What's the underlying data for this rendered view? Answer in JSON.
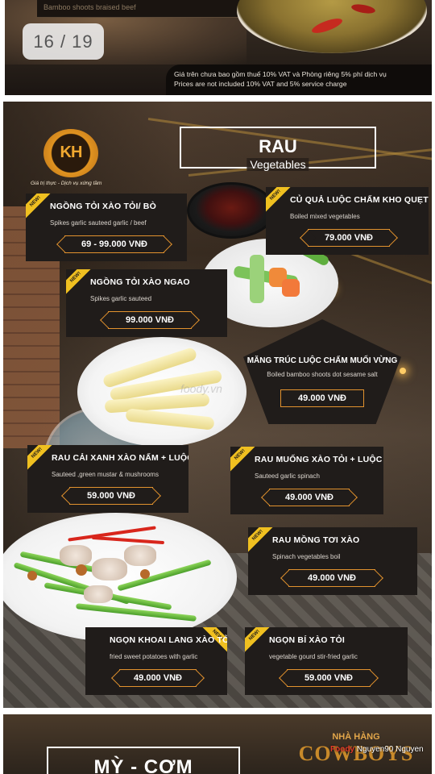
{
  "pager": {
    "label": "16 / 19"
  },
  "prev_page": {
    "band_text": "Bamboo shoots braised beef",
    "footer_vi": "Giá trên chưa bao gồm thuế 10% VAT và Phòng riêng 5% phí dịch vụ",
    "footer_en": "Prices are not included 10% VAT and 5% service charge"
  },
  "header": {
    "logo_mark": "KH",
    "tagline": "Giá trị thực - Dịch vụ xứng tầm",
    "title_vi": "RAU",
    "title_en": "Vegetables"
  },
  "badge_text": "NEW!",
  "menu_items": [
    {
      "name": "NGỒNG TỎI XÀO TỎI/ BÒ",
      "desc": "Spikes garlic sauteed garlic / beef",
      "price": "69 - 99.000 VNĐ"
    },
    {
      "name": "CỦ QUẢ LUỘC CHẤM KHO QUẸT",
      "desc": "Boiled mixed vegetables",
      "price": "79.000 VNĐ"
    },
    {
      "name": "NGỒNG TỎI XÀO NGAO",
      "desc": "Spikes garlic sauteed",
      "price": "99.000 VNĐ"
    },
    {
      "name": "MĂNG TRÚC LUỘC CHẤM MUỐI VỪNG",
      "desc": "Boiled bamboo shoots dot sesame salt",
      "price": "49.000 VNĐ"
    },
    {
      "name": "RAU CẢI XANH XÀO NẤM + LUỘC",
      "desc": "Sauteed ,green mustar & mushrooms",
      "price": "59.000 VNĐ"
    },
    {
      "name": "RAU MUỐNG XÀO TỎI + LUỘC",
      "desc": "Sauteed garlic spinach",
      "price": "49.000 VNĐ"
    },
    {
      "name": "RAU MỒNG TƠI XÀO",
      "desc": "Spinach vegetables boil",
      "price": "49.000 VNĐ"
    },
    {
      "name": "NGỌN KHOAI LANG XÀO TỎI",
      "desc": "fried sweet potatoes with garlic",
      "price": "49.000 VNĐ"
    },
    {
      "name": "NGỌN BÍ XÀO TỎI",
      "desc": "vegetable gourd stir-fried garlic",
      "price": "59.000 VNĐ"
    }
  ],
  "watermark": "foody.vn",
  "next_page": {
    "title": "MỲ - CƠM",
    "brand_small": "NHÀ HÀNG",
    "brand_big": "COWBOYS"
  },
  "credit": {
    "prefix": "Foody",
    "user": "Nguyen90 Nguyen"
  },
  "colors": {
    "accent": "#e2922e",
    "badge": "#f0c020",
    "card_bg": "#201c1a"
  }
}
